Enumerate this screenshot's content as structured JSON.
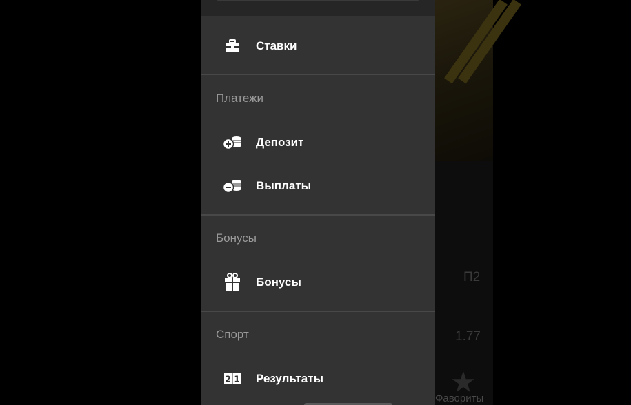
{
  "background": {
    "odds_value": "1.77",
    "col_label": "П2",
    "favorites_label": "Фавориты"
  },
  "menu": {
    "bets": {
      "label": "Ставки",
      "icon": "briefcase-icon"
    },
    "payments": {
      "title": "Платежи",
      "items": [
        {
          "label": "Депозит",
          "icon": "coins-plus-icon"
        },
        {
          "label": "Выплаты",
          "icon": "coins-minus-icon"
        }
      ]
    },
    "bonuses": {
      "title": "Бонусы",
      "items": [
        {
          "label": "Бонусы",
          "icon": "gift-icon"
        }
      ]
    },
    "sport": {
      "title": "Спорт",
      "items": [
        {
          "label": "Результаты",
          "icon": "scoreboard-icon"
        }
      ]
    }
  },
  "colors": {
    "drawer_bg": "#333333",
    "divider": "#484848",
    "section_title": "#9a9a9a",
    "item_text": "#ffffff"
  }
}
